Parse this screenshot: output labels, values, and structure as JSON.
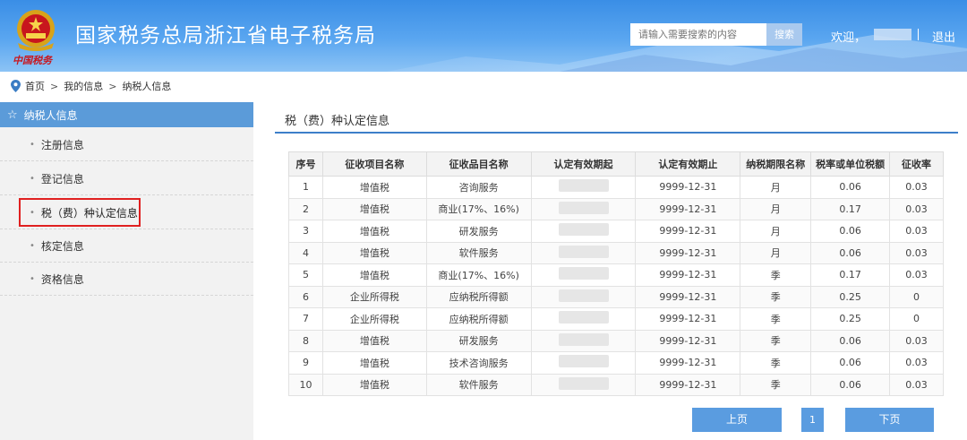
{
  "header": {
    "title": "国家税务总局浙江省电子税务局",
    "logo_text": "中国税务",
    "search_placeholder": "请输入需要搜索的内容",
    "search_button": "搜索",
    "welcome": "欢迎，",
    "logout": "退出",
    "colors": {
      "bar": "#3a8ee6",
      "search_button": "#a9c9ee"
    }
  },
  "breadcrumb": {
    "icon": "location-pin-icon",
    "items": [
      "首页",
      "我的信息",
      "纳税人信息"
    ],
    "separator": ">"
  },
  "sidebar": {
    "header": "纳税人信息",
    "header_icon": "star-icon",
    "items": [
      {
        "label": "注册信息",
        "active": false
      },
      {
        "label": "登记信息",
        "active": false
      },
      {
        "label": "税（费）种认定信息",
        "active": true
      },
      {
        "label": "核定信息",
        "active": false
      },
      {
        "label": "资格信息",
        "active": false
      }
    ],
    "colors": {
      "header_bg": "#5b9bd9",
      "active_outline": "#e02020"
    }
  },
  "main": {
    "title": "税（费）种认定信息",
    "columns": [
      "序号",
      "征收项目名称",
      "征收品目名称",
      "认定有效期起",
      "认定有效期止",
      "纳税期限名称",
      "税率或单位税额",
      "征收率"
    ],
    "rows": [
      [
        "1",
        "增值税",
        "咨询服务",
        "",
        "9999-12-31",
        "月",
        "0.06",
        "0.03"
      ],
      [
        "2",
        "增值税",
        "商业(17%、16%)",
        "",
        "9999-12-31",
        "月",
        "0.17",
        "0.03"
      ],
      [
        "3",
        "增值税",
        "研发服务",
        "",
        "9999-12-31",
        "月",
        "0.06",
        "0.03"
      ],
      [
        "4",
        "增值税",
        "软件服务",
        "",
        "9999-12-31",
        "月",
        "0.06",
        "0.03"
      ],
      [
        "5",
        "增值税",
        "商业(17%、16%)",
        "",
        "9999-12-31",
        "季",
        "0.17",
        "0.03"
      ],
      [
        "6",
        "企业所得税",
        "应纳税所得额",
        "",
        "9999-12-31",
        "季",
        "0.25",
        "0"
      ],
      [
        "7",
        "企业所得税",
        "应纳税所得额",
        "",
        "9999-12-31",
        "季",
        "0.25",
        "0"
      ],
      [
        "8",
        "增值税",
        "研发服务",
        "",
        "9999-12-31",
        "季",
        "0.06",
        "0.03"
      ],
      [
        "9",
        "增值税",
        "技术咨询服务",
        "",
        "9999-12-31",
        "季",
        "0.06",
        "0.03"
      ],
      [
        "10",
        "增值税",
        "软件服务",
        "",
        "9999-12-31",
        "季",
        "0.06",
        "0.03"
      ]
    ],
    "colors": {
      "title_underline": "#3d7fc9"
    }
  },
  "pager": {
    "prev": "上页",
    "page": "1",
    "next": "下页",
    "color": "#5a9ce0"
  }
}
